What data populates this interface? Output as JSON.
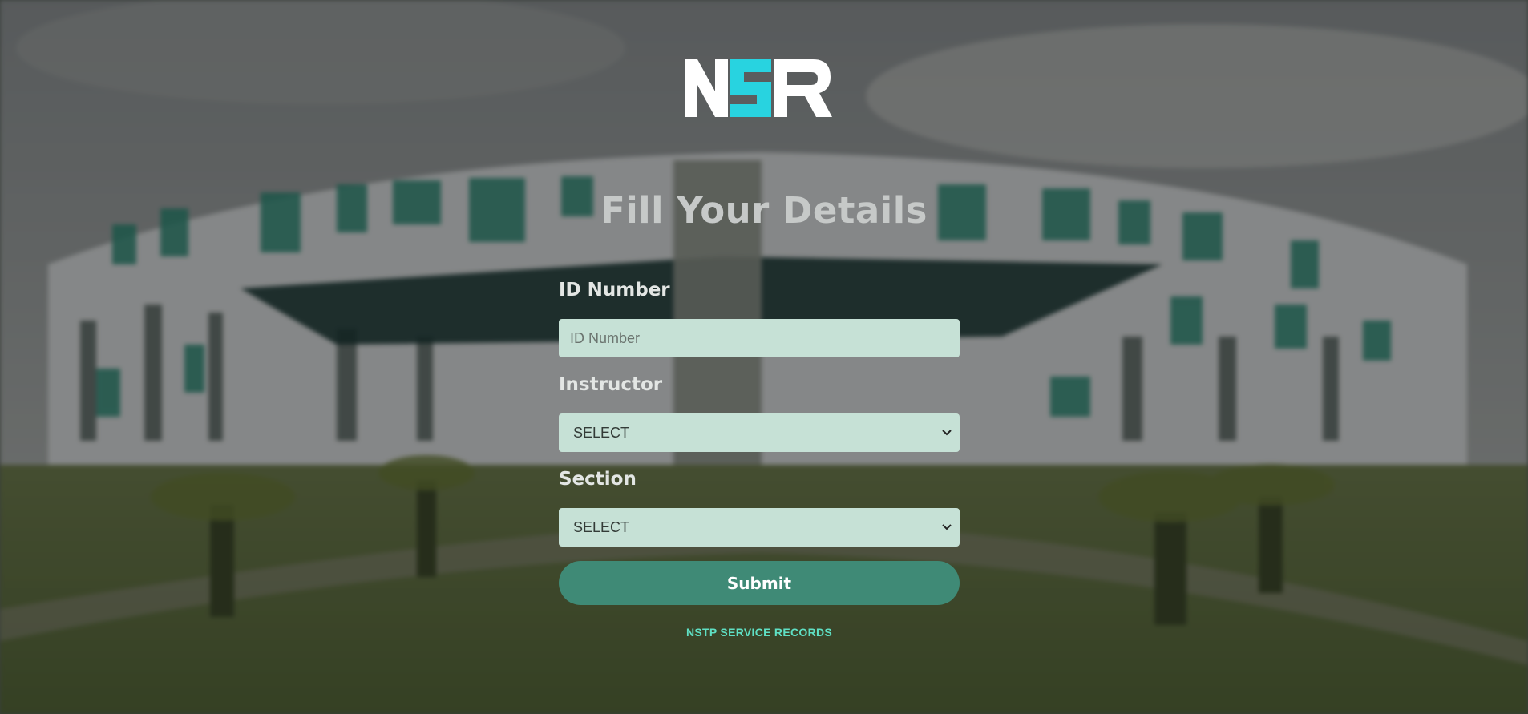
{
  "logo": {
    "text": "NSR",
    "colors": [
      "#ffffff",
      "#28d3e0"
    ]
  },
  "page": {
    "title": "Fill Your Details"
  },
  "form": {
    "id_label": "ID Number",
    "id_placeholder": "ID Number",
    "id_value": "",
    "instructor_label": "Instructor",
    "instructor_selected": "SELECT",
    "section_label": "Section",
    "section_selected": "SELECT",
    "submit_label": "Submit"
  },
  "footer": {
    "link_text": "NSTP SERVICE RECORDS"
  },
  "colors": {
    "input_bg": "#c6e1d6",
    "button_bg": "#3f8a76",
    "link": "#5fe0c4",
    "title": "#c6c9c8"
  }
}
